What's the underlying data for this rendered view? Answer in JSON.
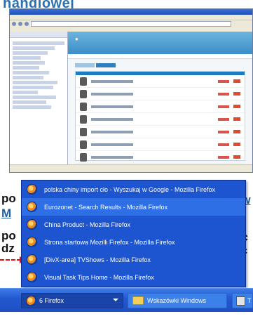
{
  "page_fragments": {
    "top_word": "handlowej",
    "left_lines": [
      "po",
      "M",
      "po",
      "dz"
    ],
    "right_lines": [
      "ów",
      "dc",
      "ec"
    ]
  },
  "popup_menu": {
    "items": [
      {
        "label": "polska chiny import cło - Wyszukaj w Google - Mozilla Firefox",
        "icon": "firefox-icon",
        "hovered": false
      },
      {
        "label": "Eurozonet - Search Results - Mozilla Firefox",
        "icon": "firefox-icon",
        "hovered": true
      },
      {
        "label": "China Product - Mozilla Firefox",
        "icon": "firefox-icon",
        "hovered": false
      },
      {
        "label": "Strona startowa Mozilli Firefox - Mozilla Firefox",
        "icon": "firefox-icon",
        "hovered": false
      },
      {
        "label": "[DivX-area] TVShows - Mozilla Firefox",
        "icon": "firefox-icon",
        "hovered": false
      },
      {
        "label": "Visual Task Tips Home - Mozilla Firefox",
        "icon": "firefox-icon",
        "hovered": false
      }
    ]
  },
  "taskbar": {
    "group_button_label": "6 Firefox",
    "explorer_button_label": "Wskazówki Windows",
    "third_button_label": "T"
  },
  "colors": {
    "menu_bg": "#1c55cf",
    "menu_hover": "#2f6fe6",
    "taskbar": "#2458d0",
    "arrow": "#dd1111"
  }
}
